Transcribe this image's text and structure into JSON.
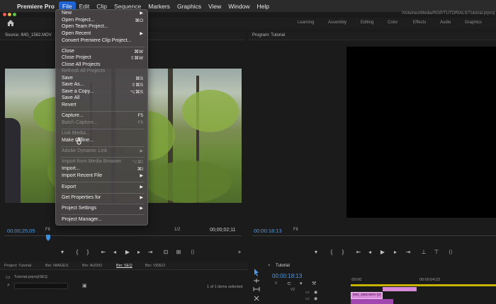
{
  "menubar": {
    "app": "Premiere Pro",
    "menus": [
      "File",
      "Edit",
      "Clip",
      "Sequence",
      "Markers",
      "Graphics",
      "View",
      "Window",
      "Help"
    ]
  },
  "title_path": "/Volumes/Media/RGP/TUTORIALS/Tutorial.prproj",
  "workspaces": [
    "Learning",
    "Assembly",
    "Editing",
    "Color",
    "Effects",
    "Audio",
    "Graphics"
  ],
  "source": {
    "tab": "Source: IMG_1562.MOV",
    "timecode": "00;00;25;05",
    "fit": "Fit",
    "ratio": "1/2",
    "duration": "00;00;02;11"
  },
  "program": {
    "tab": "Program: Tutorial",
    "timecode": "00:00:18:13",
    "fit": "Fit"
  },
  "project": {
    "tabs": [
      "Project: Tutorial",
      "Bin: IMAGES",
      "Bin: AUDIO",
      "Bin: SEQ",
      "Bin: VIDEO"
    ],
    "path": "Tutorial.prproj\\SEQ",
    "items": "1 of 1 items selected"
  },
  "timeline": {
    "tab": "Tutorial",
    "timecode": "00:00:18:13",
    "ruler": [
      ":00:00",
      "00:00:04:23"
    ],
    "clip_label": "IMG_1562.MOV [V]"
  },
  "file_menu": {
    "items": [
      {
        "label": "New",
        "shortcut": "",
        "submenu": true,
        "disabled": false
      },
      {
        "label": "Open Project...",
        "shortcut": "⌘O",
        "submenu": false,
        "disabled": false
      },
      {
        "label": "Open Team Project...",
        "shortcut": "",
        "submenu": false,
        "disabled": false
      },
      {
        "label": "Open Recent",
        "shortcut": "",
        "submenu": true,
        "disabled": false
      },
      {
        "label": "Convert Premiere Clip Project...",
        "shortcut": "",
        "submenu": false,
        "disabled": false
      },
      {
        "label": "Close",
        "shortcut": "⌘W",
        "submenu": false,
        "disabled": false
      },
      {
        "label": "Close Project",
        "shortcut": "⇧⌘W",
        "submenu": false,
        "disabled": false
      },
      {
        "label": "Close All Projects",
        "shortcut": "",
        "submenu": false,
        "disabled": false
      },
      {
        "label": "Refresh All Projects",
        "shortcut": "",
        "submenu": false,
        "disabled": true
      },
      {
        "label": "Save",
        "shortcut": "⌘S",
        "submenu": false,
        "disabled": false
      },
      {
        "label": "Save As...",
        "shortcut": "⇧⌘S",
        "submenu": false,
        "disabled": false
      },
      {
        "label": "Save a Copy...",
        "shortcut": "⌥⌘S",
        "submenu": false,
        "disabled": false
      },
      {
        "label": "Save All",
        "shortcut": "",
        "submenu": false,
        "disabled": false
      },
      {
        "label": "Revert",
        "shortcut": "",
        "submenu": false,
        "disabled": false
      },
      {
        "label": "Capture...",
        "shortcut": "F5",
        "submenu": false,
        "disabled": false
      },
      {
        "label": "Batch Capture...",
        "shortcut": "F6",
        "submenu": false,
        "disabled": true
      },
      {
        "label": "Link Media...",
        "shortcut": "",
        "submenu": false,
        "disabled": true
      },
      {
        "label": "Make Offline...",
        "shortcut": "",
        "submenu": false,
        "disabled": false
      },
      {
        "label": "Adobe Dynamic Link",
        "shortcut": "",
        "submenu": true,
        "disabled": true
      },
      {
        "label": "Import from Media Browser",
        "shortcut": "⌥⌘I",
        "submenu": false,
        "disabled": true
      },
      {
        "label": "Import...",
        "shortcut": "⌘I",
        "submenu": false,
        "disabled": false
      },
      {
        "label": "Import Recent File",
        "shortcut": "",
        "submenu": true,
        "disabled": false
      },
      {
        "label": "Export",
        "shortcut": "",
        "submenu": true,
        "disabled": false
      },
      {
        "label": "Get Properties for",
        "shortcut": "",
        "submenu": true,
        "disabled": false
      },
      {
        "label": "Project Settings",
        "shortcut": "",
        "submenu": true,
        "disabled": false
      },
      {
        "label": "Project Manager...",
        "shortcut": "",
        "submenu": false,
        "disabled": false
      }
    ]
  },
  "colors": {
    "accent": "#1f63d6",
    "timecode": "#4d9be8",
    "clip": "#d68ad8"
  }
}
